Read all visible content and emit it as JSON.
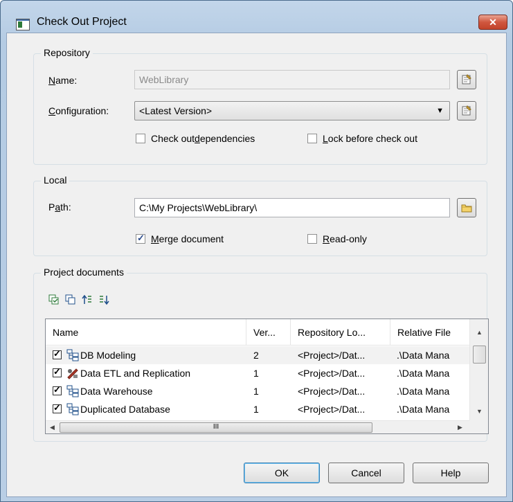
{
  "window": {
    "title": "Check Out Project",
    "close_label": "✕"
  },
  "repository": {
    "group_label": "Repository",
    "name_label_pre": "",
    "name_label_u": "N",
    "name_label_post": "ame:",
    "name_value": "WebLibrary",
    "config_label_u": "C",
    "config_label_post": "onfiguration:",
    "config_value": "<Latest Version>",
    "check_out_deps_pre": "Check out ",
    "check_out_deps_u": "d",
    "check_out_deps_post": "ependencies",
    "check_out_deps_checked": false,
    "lock_u": "L",
    "lock_post": "ock before check out",
    "lock_checked": false
  },
  "local": {
    "group_label": "Local",
    "path_label_pre": "P",
    "path_label_u": "a",
    "path_label_post": "th:",
    "path_value": "C:\\My Projects\\WebLibrary\\",
    "merge_u": "M",
    "merge_post": "erge document",
    "merge_checked": true,
    "readonly_u": "R",
    "readonly_post": "ead-only",
    "readonly_checked": false
  },
  "documents": {
    "group_label": "Project documents",
    "toolbar": [
      "select-all-icon",
      "deselect-all-icon",
      "move-up-icon",
      "move-down-icon"
    ],
    "columns": [
      "Name",
      "Ver...",
      "Repository Lo...",
      "Relative File"
    ],
    "rows": [
      {
        "name": "DB Modeling",
        "version": "2",
        "repo": "<Project>/Dat...",
        "rel": ".\\Data Mana",
        "icon": "model-icon",
        "checked": true
      },
      {
        "name": "Data ETL and Replication",
        "version": "1",
        "repo": "<Project>/Dat...",
        "rel": ".\\Data Mana",
        "icon": "etl-icon",
        "checked": true
      },
      {
        "name": "Data Warehouse",
        "version": "1",
        "repo": "<Project>/Dat...",
        "rel": ".\\Data Mana",
        "icon": "model-icon",
        "checked": true
      },
      {
        "name": "Duplicated Database",
        "version": "1",
        "repo": "<Project>/Dat...",
        "rel": ".\\Data Mana",
        "icon": "model-icon",
        "checked": true
      }
    ],
    "hscroll_grip": "III"
  },
  "buttons": {
    "ok": "OK",
    "cancel": "Cancel",
    "help": "Help"
  }
}
